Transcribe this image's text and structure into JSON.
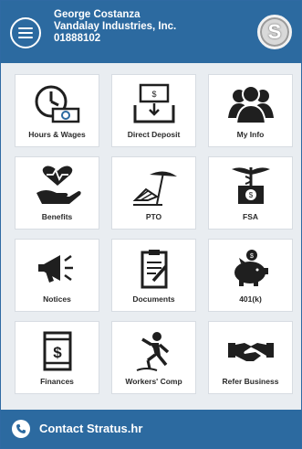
{
  "header": {
    "user_name": "George Costanza",
    "company": "Vandalay Industries, Inc.",
    "employee_id": "01888102",
    "logo_letter": "S"
  },
  "tiles": [
    {
      "label": "Hours & Wages",
      "icon": "clock-money-icon"
    },
    {
      "label": "Direct Deposit",
      "icon": "direct-deposit-icon"
    },
    {
      "label": "My Info",
      "icon": "people-icon"
    },
    {
      "label": "Benefits",
      "icon": "hand-heart-icon"
    },
    {
      "label": "PTO",
      "icon": "beach-chair-icon"
    },
    {
      "label": "FSA",
      "icon": "caduceus-money-icon"
    },
    {
      "label": "Notices",
      "icon": "megaphone-icon"
    },
    {
      "label": "Documents",
      "icon": "clipboard-icon"
    },
    {
      "label": "401(k)",
      "icon": "piggy-bank-icon"
    },
    {
      "label": "Finances",
      "icon": "ledger-dollar-icon"
    },
    {
      "label": "Workers' Comp",
      "icon": "slip-fall-icon"
    },
    {
      "label": "Refer Business",
      "icon": "handshake-icon"
    }
  ],
  "footer": {
    "contact_label": "Contact Stratus.hr",
    "icon": "phone-icon"
  },
  "colors": {
    "brand_blue": "#2c6aa0",
    "icon_dark": "#1f1f1f",
    "background": "#e9edf1"
  }
}
